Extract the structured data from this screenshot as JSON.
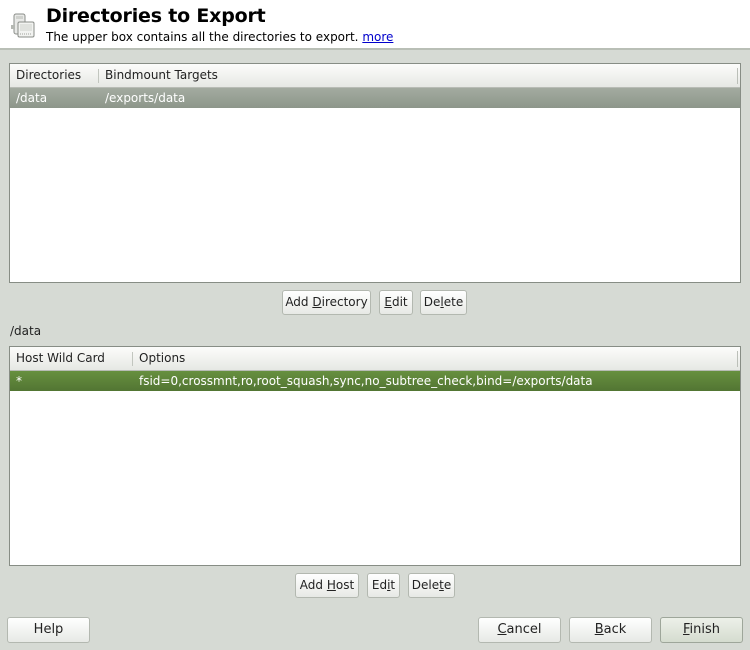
{
  "header": {
    "icon": "nfs-server-icon",
    "title": "Directories to Export",
    "subtitle": "The upper box contains all the directories to export.",
    "more_link": "more"
  },
  "directories_table": {
    "columns": [
      "Directories",
      "Bindmount Targets"
    ],
    "rows": [
      {
        "directory": "/data",
        "target": "/exports/data",
        "selected": true
      }
    ],
    "selection_color": "#96a093"
  },
  "directory_buttons": {
    "add": {
      "pre": "Add ",
      "mn": "D",
      "post": "irectory"
    },
    "edit": {
      "pre": "",
      "mn": "E",
      "post": "dit"
    },
    "delete": {
      "pre": "De",
      "mn": "l",
      "post": "ete"
    }
  },
  "selected_directory_label": "/data",
  "hosts_table": {
    "columns": [
      "Host Wild Card",
      "Options"
    ],
    "rows": [
      {
        "host": "*",
        "options": "fsid=0,crossmnt,ro,root_squash,sync,no_subtree_check,bind=/exports/data",
        "selected": true
      }
    ],
    "selection_color": "#5c8239"
  },
  "host_buttons": {
    "add": {
      "pre": "Add ",
      "mn": "H",
      "post": "ost"
    },
    "edit": {
      "pre": "Ed",
      "mn": "i",
      "post": "t"
    },
    "delete": {
      "pre": "Dele",
      "mn": "t",
      "post": "e"
    }
  },
  "footer": {
    "help": "Help",
    "cancel": {
      "pre": "",
      "mn": "C",
      "post": "ancel"
    },
    "back": {
      "pre": "",
      "mn": "B",
      "post": "ack"
    },
    "finish": {
      "pre": "",
      "mn": "F",
      "post": "inish"
    }
  }
}
